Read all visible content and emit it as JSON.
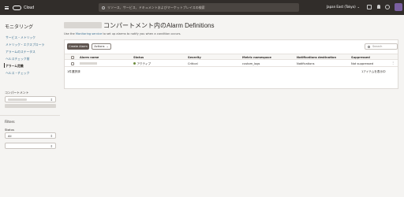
{
  "topbar": {
    "brand": "Cloud",
    "search_placeholder": "リソース、サービス、ドキュメントおよびマーケットプレイスの検索",
    "region": "Japan East (Tokyo)",
    "region_chevron": "⌄"
  },
  "sidebar": {
    "title": "モニタリング",
    "items": [
      {
        "label": "サービス・メトリック"
      },
      {
        "label": "メトリック・エクスプローラ"
      },
      {
        "label": "アラームのステータス"
      },
      {
        "label": "ヘルスチェック前"
      },
      {
        "label": "アラーム定義"
      },
      {
        "label": "ヘルス・チェック"
      }
    ],
    "compartment_label": "コンパートメント",
    "filters_label": "Filters",
    "status_label": "Status",
    "status_value": "All"
  },
  "main": {
    "title_suffix": "コンパートメント内のAlarm Definitions",
    "desc_prefix": "Use the",
    "desc_link": "Monitoring service",
    "desc_suffix": "to set up alarms to notify you when a condition occurs.",
    "create_label": "Create Alarm",
    "actions_label": "Actions",
    "search_placeholder": "Search",
    "columns": [
      "Alarm name",
      "Status",
      "Severity",
      "Metric namespace",
      "Notifications destination",
      "Suppressed"
    ],
    "rows": [
      {
        "status": "アクティブ",
        "severity": "Critical",
        "namespace": "custom_logs",
        "destination": "Notifications",
        "suppressed": "Not suppressed"
      }
    ],
    "footer_left": "1件選択済",
    "footer_right": "1アイテムを表示中"
  }
}
